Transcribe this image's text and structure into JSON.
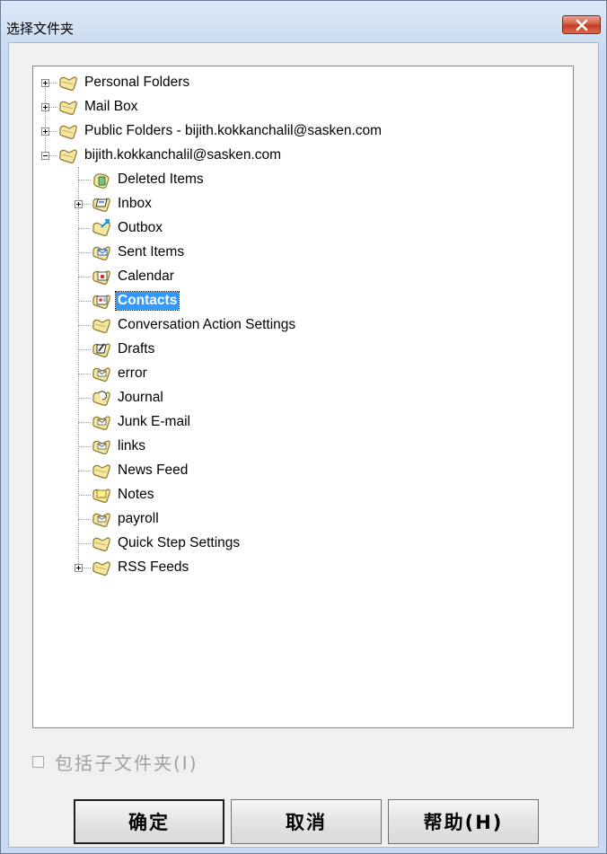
{
  "window": {
    "title": "选择文件夹"
  },
  "tree": {
    "nodes": [
      {
        "label": "Personal Folders",
        "level": 0,
        "expander": "plus",
        "icon": "folder-icon"
      },
      {
        "label": "Mail Box",
        "level": 0,
        "expander": "plus",
        "icon": "folder-icon"
      },
      {
        "label": "Public Folders - bijith.kokkanchalil@sasken.com",
        "level": 0,
        "expander": "plus",
        "icon": "folder-icon"
      },
      {
        "label": "bijith.kokkanchalil@sasken.com",
        "level": 0,
        "expander": "minus",
        "icon": "folder-icon"
      },
      {
        "label": "Deleted Items",
        "level": 1,
        "expander": "none",
        "icon": "deleted-items-icon"
      },
      {
        "label": "Inbox",
        "level": 1,
        "expander": "plus",
        "icon": "inbox-icon"
      },
      {
        "label": "Outbox",
        "level": 1,
        "expander": "none",
        "icon": "outbox-icon"
      },
      {
        "label": "Sent Items",
        "level": 1,
        "expander": "none",
        "icon": "sent-items-icon"
      },
      {
        "label": "Calendar",
        "level": 1,
        "expander": "none",
        "icon": "calendar-icon"
      },
      {
        "label": "Contacts",
        "level": 1,
        "expander": "none",
        "icon": "contacts-icon",
        "selected": true
      },
      {
        "label": "Conversation Action Settings",
        "level": 1,
        "expander": "none",
        "icon": "folder-icon"
      },
      {
        "label": "Drafts",
        "level": 1,
        "expander": "none",
        "icon": "drafts-icon"
      },
      {
        "label": "error",
        "level": 1,
        "expander": "none",
        "icon": "mail-folder-icon"
      },
      {
        "label": "Journal",
        "level": 1,
        "expander": "none",
        "icon": "journal-icon"
      },
      {
        "label": "Junk E-mail",
        "level": 1,
        "expander": "none",
        "icon": "mail-folder-icon"
      },
      {
        "label": "links",
        "level": 1,
        "expander": "none",
        "icon": "mail-folder-icon"
      },
      {
        "label": "News Feed",
        "level": 1,
        "expander": "none",
        "icon": "folder-icon"
      },
      {
        "label": "Notes",
        "level": 1,
        "expander": "none",
        "icon": "notes-icon"
      },
      {
        "label": "payroll",
        "level": 1,
        "expander": "none",
        "icon": "mail-folder-icon"
      },
      {
        "label": "Quick Step Settings",
        "level": 1,
        "expander": "none",
        "icon": "folder-icon"
      },
      {
        "label": "RSS Feeds",
        "level": 1,
        "expander": "plus",
        "icon": "folder-icon"
      }
    ]
  },
  "options": {
    "include_subfolders_label": "包括子文件夹(I)",
    "include_subfolders_checked": false
  },
  "buttons": {
    "ok": "确定",
    "cancel": "取消",
    "help": "帮助(H)"
  },
  "colors": {
    "selection": "#3399ff",
    "folder_fill": "#f3e7a3",
    "close_button": "#c94a35"
  }
}
